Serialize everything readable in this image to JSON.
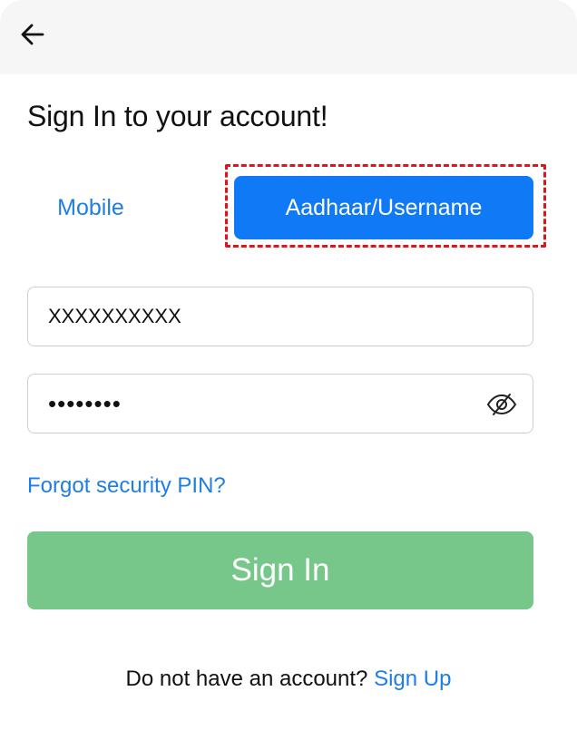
{
  "header": {
    "back_icon": "arrow-left-icon"
  },
  "page": {
    "title": "Sign In to your account!"
  },
  "tabs": {
    "mobile_label": "Mobile",
    "username_label": "Aadhaar/Username",
    "active": "username",
    "active_color": "#1079f5",
    "highlight_color": "#e0151b"
  },
  "form": {
    "username_value": "XXXXXXXXXX",
    "password_masked": "••••••••",
    "password_toggle_icon": "eye-slash-icon"
  },
  "links": {
    "forgot_pin": "Forgot security PIN?"
  },
  "actions": {
    "signin_label": "Sign In",
    "signin_color": "#77c78a"
  },
  "footer": {
    "prompt": "Do not have an account? ",
    "signup_label": "Sign Up"
  }
}
